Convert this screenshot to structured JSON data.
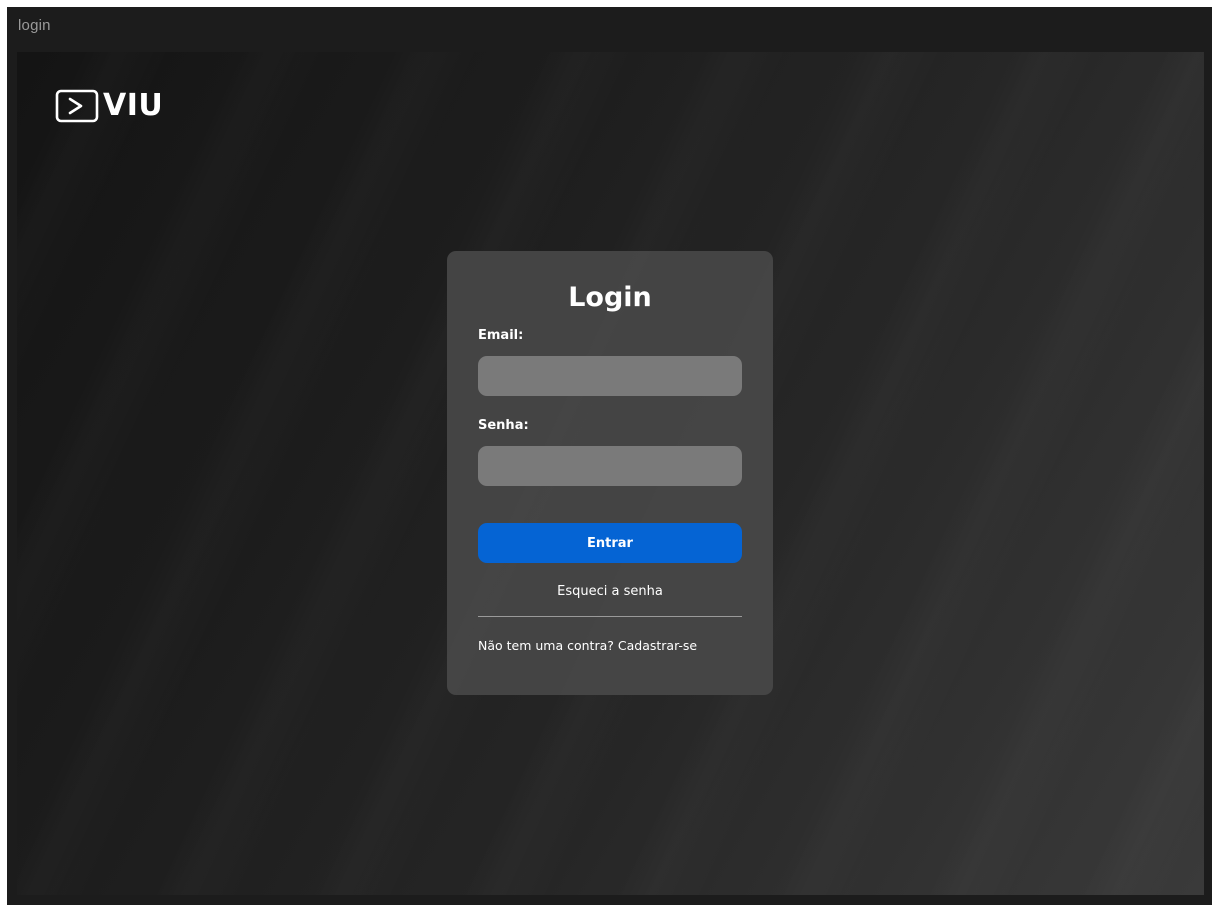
{
  "window": {
    "title": "login"
  },
  "brand": {
    "name": "VIU",
    "icon": "play-box-icon"
  },
  "login_card": {
    "title": "Login",
    "email_label": "Email:",
    "email_value": "",
    "password_label": "Senha:",
    "password_value": "",
    "submit_label": "Entrar",
    "forgot_link": "Esqueci a senha",
    "signup_prompt": "Não tem uma contra?",
    "signup_link": "Cadastrar-se"
  },
  "colors": {
    "primary_button": "#0564d4",
    "card_background": "#484848",
    "input_background": "#7a7a7a"
  }
}
